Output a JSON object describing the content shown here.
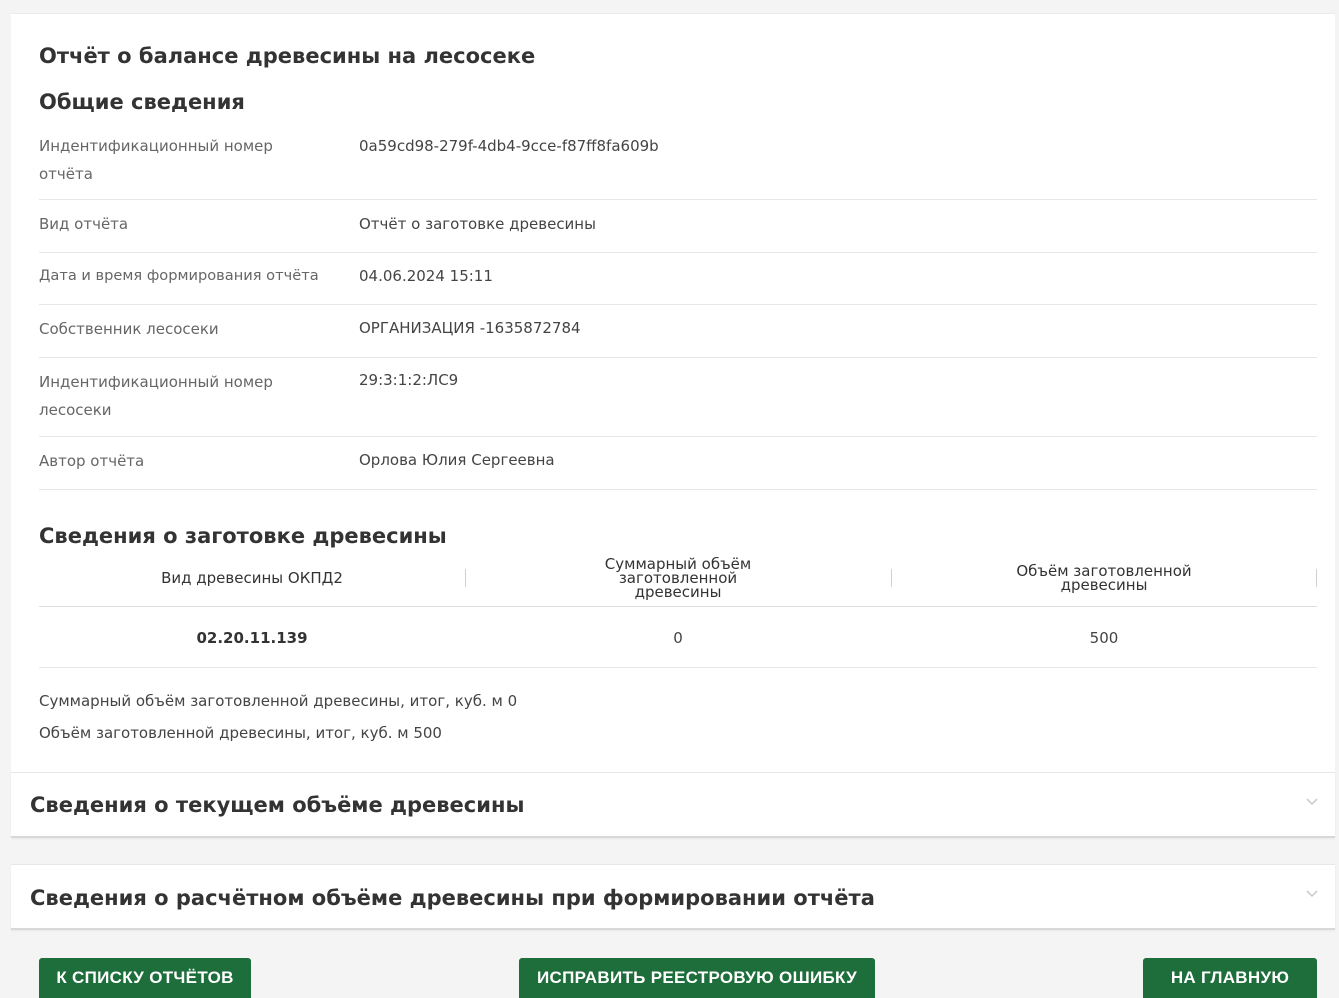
{
  "report_title": "Отчёт о балансе древесины на лесосеке",
  "general": {
    "title": "Общие сведения",
    "rows": [
      {
        "label": "Индентификационный номер отчёта",
        "value": "0a59cd98-279f-4db4-9cce-f87ff8fa609b"
      },
      {
        "label": "Вид отчёта",
        "value": "Отчёт о заготовке древесины"
      },
      {
        "label": "Дата и время формирования отчёта",
        "value": "04.06.2024 15:11"
      },
      {
        "label": "Собственник лесосеки",
        "value": "ОРГАНИЗАЦИЯ -1635872784"
      },
      {
        "label": "Индентификационный номер лесосеки",
        "value": "29:3:1:2:ЛС9"
      },
      {
        "label": "Автор отчёта",
        "value": "Орлова Юлия Сергеевна"
      }
    ]
  },
  "harvest": {
    "title": "Сведения о заготовке древесины",
    "columns": [
      "Вид древесины ОКПД2",
      "Суммарный объём заготовленной древесины",
      "Объём заготовленной древесины"
    ],
    "rows": [
      [
        "02.20.11.139",
        "0",
        "500"
      ]
    ],
    "total_sum": "Суммарный объём заготовленной древесины, итог, куб. м 0",
    "total_volume": "Объём заготовленной древесины, итог, куб. м 500"
  },
  "accordions": [
    {
      "title": "Сведения о текущем объёме древесины",
      "icon": "chevron-down-icon"
    },
    {
      "title": "Сведения о расчётном объёме древесины при формировании отчёта",
      "icon": "chevron-down-icon"
    }
  ],
  "buttons": {
    "to_list": "К СПИСКУ ОТЧЁТОВ",
    "fix_error": "ИСПРАВИТЬ РЕЕСТРОВУЮ ОШИБКУ",
    "home": "НА ГЛАВНУЮ"
  },
  "colors": {
    "button_green": "#1e6e3c"
  }
}
